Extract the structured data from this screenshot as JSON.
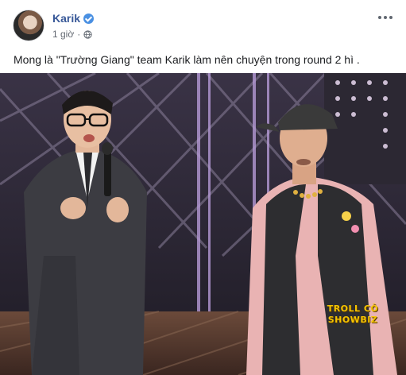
{
  "post": {
    "author": "Karik",
    "verified": true,
    "time": "1 giờ",
    "audience_icon": "globe-icon",
    "more_icon": "more-options-icon",
    "text": "Mong là \"Trường Giang\" team Karik làm nên chuyện trong round 2 hì ."
  },
  "image": {
    "watermark": "TROLL CÔ SHOWBIZ"
  },
  "colors": {
    "author_link": "#385898",
    "verified_badge": "#4a90e2",
    "meta_text": "#616770"
  }
}
